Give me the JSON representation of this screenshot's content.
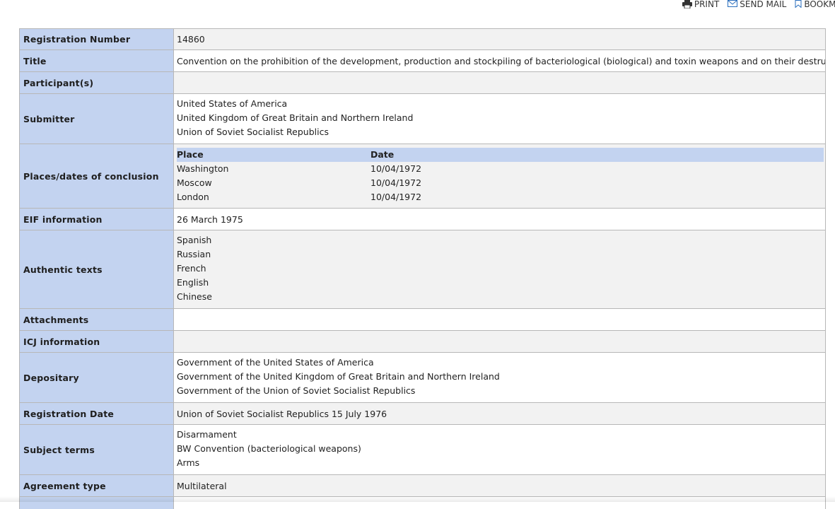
{
  "toolbar": {
    "print_label": "PRINT",
    "send_mail_label": "SEND MAIL",
    "bookmark_label": "BOOKMAR"
  },
  "record": {
    "registration_number": {
      "label": "Registration Number",
      "value": "14860"
    },
    "title": {
      "label": "Title",
      "value": "Convention on the prohibition of the development, production and stockpiling of bacteriological (biological) and toxin weapons and on their destruction"
    },
    "participants": {
      "label": "Participant(s)",
      "value": ""
    },
    "submitter": {
      "label": "Submitter",
      "values": [
        "United States of America",
        "United Kingdom of Great Britain and Northern Ireland",
        "Union of Soviet Socialist Republics"
      ]
    },
    "places_dates": {
      "label": "Places/dates of conclusion",
      "headers": {
        "place": "Place",
        "date": "Date"
      },
      "rows": [
        {
          "place": "Washington",
          "date": "10/04/1972"
        },
        {
          "place": "Moscow",
          "date": "10/04/1972"
        },
        {
          "place": "London",
          "date": "10/04/1972"
        }
      ]
    },
    "eif_information": {
      "label": "EIF information",
      "value": "26 March 1975"
    },
    "authentic_texts": {
      "label": "Authentic texts",
      "values": [
        "Spanish",
        "Russian",
        "French",
        "English",
        "Chinese"
      ]
    },
    "attachments": {
      "label": "Attachments",
      "value": ""
    },
    "icj_information": {
      "label": "ICJ information",
      "value": ""
    },
    "depositary": {
      "label": "Depositary",
      "values": [
        "Government of the United States of America",
        "Government of the United Kingdom of Great Britain and Northern Ireland",
        "Government of the Union of Soviet Socialist Republics"
      ]
    },
    "registration_date": {
      "label": "Registration Date",
      "value": "Union of Soviet Socialist Republics 15 July 1976"
    },
    "subject_terms": {
      "label": "Subject terms",
      "values": [
        "Disarmament",
        "BW Convention (bacteriological weapons)",
        "Arms"
      ]
    },
    "agreement_type": {
      "label": "Agreement type",
      "value": "Multilateral"
    }
  }
}
